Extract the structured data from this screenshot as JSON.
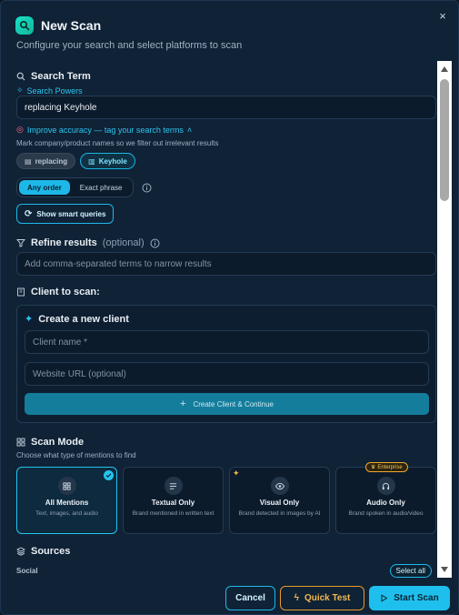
{
  "header": {
    "title": "New Scan",
    "subtitle": "Configure your search and select platforms to scan",
    "close_label": "×"
  },
  "search": {
    "title": "Search Term",
    "powers_link": "Search Powers",
    "value": "replacing Keyhole",
    "improve_link": "Improve accuracy — tag your search terms",
    "hint": "Mark company/product names so we filter out irrelevant results",
    "chips": [
      {
        "label": "replacing",
        "tagged": false
      },
      {
        "label": "Keyhole",
        "tagged": true
      }
    ],
    "order_options": [
      "Any order",
      "Exact phrase"
    ],
    "selected_order": "Any order",
    "smart_queries_label": "Show smart queries"
  },
  "refine": {
    "title": "Refine results",
    "optional": "(optional)",
    "placeholder": "Add comma-separated terms to narrow results"
  },
  "client": {
    "title": "Client to scan:",
    "create_title": "Create a new client",
    "name_placeholder": "Client name *",
    "url_placeholder": "Website URL (optional)",
    "create_button": "Create Client & Continue"
  },
  "scan_mode": {
    "title": "Scan Mode",
    "subtitle": "Choose what type of mentions to find",
    "modes": [
      {
        "name": "All Mentions",
        "desc": "Text, images, and audio",
        "selected": true
      },
      {
        "name": "Textual Only",
        "desc": "Brand mentioned in written text",
        "selected": false
      },
      {
        "name": "Visual Only",
        "desc": "Brand detected in images by AI",
        "selected": false
      },
      {
        "name": "Audio Only",
        "desc": "Brand spoken in audio/video",
        "selected": false,
        "badge": "Enterprise"
      }
    ]
  },
  "sources": {
    "title": "Sources",
    "group": "Social",
    "select_all": "Select all"
  },
  "footer": {
    "cancel": "Cancel",
    "quick_test": "Quick Test",
    "start_scan": "Start Scan"
  },
  "colors": {
    "accent": "#1fbfed",
    "warning": "#e59a2a",
    "background": "#0f2236"
  }
}
